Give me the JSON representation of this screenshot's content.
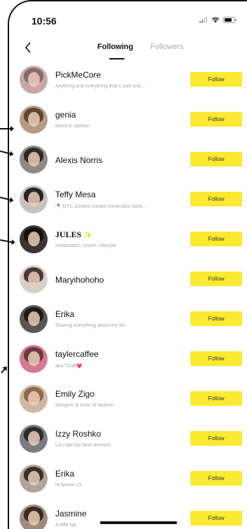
{
  "status_bar": {
    "time": "10:56",
    "icons": [
      "signal-icon",
      "wifi-icon",
      "battery-icon"
    ]
  },
  "header": {
    "back_icon": "chevron-left-icon",
    "tabs": [
      {
        "label": "Following",
        "active": true
      },
      {
        "label": "Followers",
        "active": false
      }
    ]
  },
  "colors": {
    "follow_button": "#fbea31",
    "active_tab": "#111111",
    "inactive_tab": "#aaaaaa",
    "bio_text": "#a6a6a6"
  },
  "follow_label": "Follow",
  "accounts": [
    {
      "name": "PickMeCore",
      "bio": "Anything and everything that's cool and..."
    },
    {
      "name": "genia",
      "bio": "fluent in fashion"
    },
    {
      "name": "Alexis Norris",
      "bio": ""
    },
    {
      "name": "Teffy Mesa",
      "bio": "📍 NYC content creator minimalist fashi..."
    },
    {
      "name": "JULES",
      "bio": "restaurants / travel / lifestyle"
    },
    {
      "name": "Maryihohoho",
      "bio": ""
    },
    {
      "name": "Erika",
      "bio": "Sharing everything about my life"
    },
    {
      "name": "taylercaffee",
      "bio": "aka TCaff💗"
    },
    {
      "name": "Emily Zigo",
      "bio": "designer & lover of fashion"
    },
    {
      "name": "Izzy Roshko",
      "bio": "LA | late but best dressed"
    },
    {
      "name": "Erika",
      "bio": "Hi bestie <3"
    },
    {
      "name": "Jasmine",
      "bio": "A little typ"
    }
  ]
}
